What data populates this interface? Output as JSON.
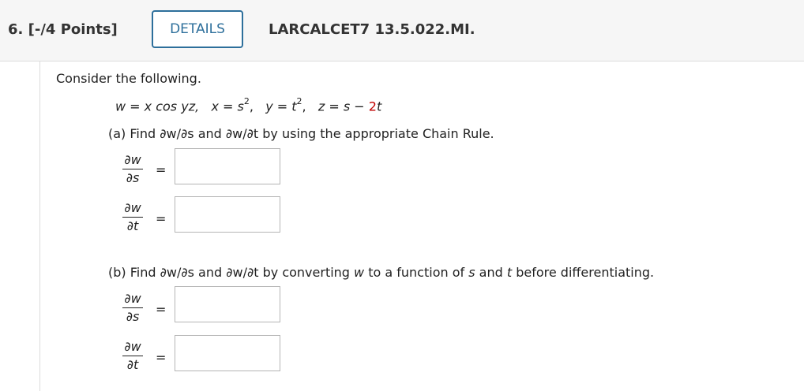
{
  "header": {
    "question_number": "6.  [-/4 Points]",
    "details_label": "DETAILS",
    "question_id": "LARCALCET7 13.5.022.MI."
  },
  "body": {
    "intro": "Consider the following.",
    "equation": {
      "w_def": "w = x cos yz,",
      "x_def": "x = s",
      "y_def": "y = t",
      "z_prefix": "z = s − ",
      "z_highlight": "2",
      "z_var": "t",
      "exp": "2"
    },
    "part_a": {
      "label": "(a) Find ∂w/∂s and ∂w/∂t by using the appropriate Chain Rule."
    },
    "part_b": {
      "label_prefix": "(b) Find ∂w/∂s and ∂w/∂t by converting ",
      "w": "w",
      "mid1": " to a function of ",
      "s": "s",
      "mid2": " and ",
      "t": "t",
      "suffix": " before differentiating."
    },
    "fractions": {
      "dw": "∂w",
      "ds": "∂s",
      "dt": "∂t",
      "equals": "="
    },
    "answers": {
      "a_dw_ds": "",
      "a_dw_dt": "",
      "b_dw_ds": "",
      "b_dw_dt": ""
    }
  }
}
